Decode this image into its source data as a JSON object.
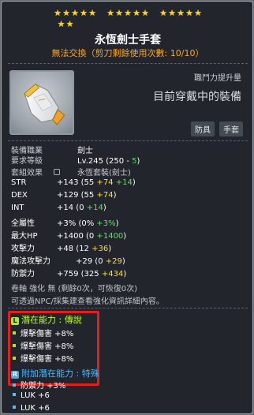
{
  "stars": {
    "row1_filled": 15,
    "row2_filled": 2,
    "row2_empty": 0
  },
  "item": {
    "name": "永恆劍士手套",
    "trade_info": "無法交換（剪刀剩餘使用次數: 10/10）"
  },
  "header": {
    "power_label": "職鬥力提升量",
    "wearing_text": "目前穿戴中的裝備",
    "tags": [
      "防具",
      "手套"
    ]
  },
  "requirements": {
    "job_label": "裝備職業",
    "job_value": "劍士",
    "level_label": "要求等級",
    "level_prefix": "Lv.245 (250 -",
    "level_reduction": " 5",
    "level_suffix": ")"
  },
  "set": {
    "label": "套組效果",
    "value": "永恆套裝(劍士)"
  },
  "stats": [
    {
      "name": "STR",
      "total": "+143",
      "base": "(55",
      "add1": "+74",
      "add2": "+14",
      "end": ")"
    },
    {
      "name": "DEX",
      "total": "+129",
      "base": "(55",
      "add1": "+74",
      "add2": "",
      "end": ")"
    },
    {
      "name": "INT",
      "total": "+14",
      "base": "(0",
      "add1": "",
      "add2": "+14",
      "end": ")"
    },
    {
      "name": "全屬性",
      "total": "+3%",
      "base": "(0%",
      "add1": "",
      "add2": "+3%",
      "end": ")"
    },
    {
      "name": "最大HP",
      "total": "+1400",
      "base": "(0",
      "add1": "",
      "add2": "+1400",
      "end": ")"
    },
    {
      "name": "攻擊力",
      "total": "+48",
      "base": "(12",
      "add1": "",
      "add2": "",
      "add3": "+36",
      "end": ")"
    },
    {
      "name": "魔法攻擊力",
      "total": "+29",
      "base": "(0",
      "add1": "",
      "add2": "",
      "add3": "+29",
      "end": ")"
    },
    {
      "name": "防禦力",
      "total": "+759",
      "base": "(325",
      "add1": "",
      "add2": "",
      "add3": "+434",
      "end": ")"
    }
  ],
  "scroll_info": "卷軸 強化 無 (剩餘0次，可恢復0次)",
  "cube_hint": "可透過NPC/採集建查看強化資訊詳細內容。",
  "potential": {
    "header": "潛在能力 : 傳說",
    "badge": "L",
    "lines": [
      "爆擊傷害 +8%",
      "爆擊傷害 +8%",
      "爆擊傷害 +8%"
    ]
  },
  "additional_potential": {
    "header": "附加潛在能力 : 特殊",
    "badge": "R",
    "lines": [
      "防禦力 +3%",
      "LUK +6",
      "LUK +6"
    ]
  },
  "colors": {
    "star": "#ffd320",
    "trade": "#ffa520",
    "legendary": "#c1ff22",
    "additional": "#4ab8ff",
    "highlight_box": "#e31e1e"
  }
}
